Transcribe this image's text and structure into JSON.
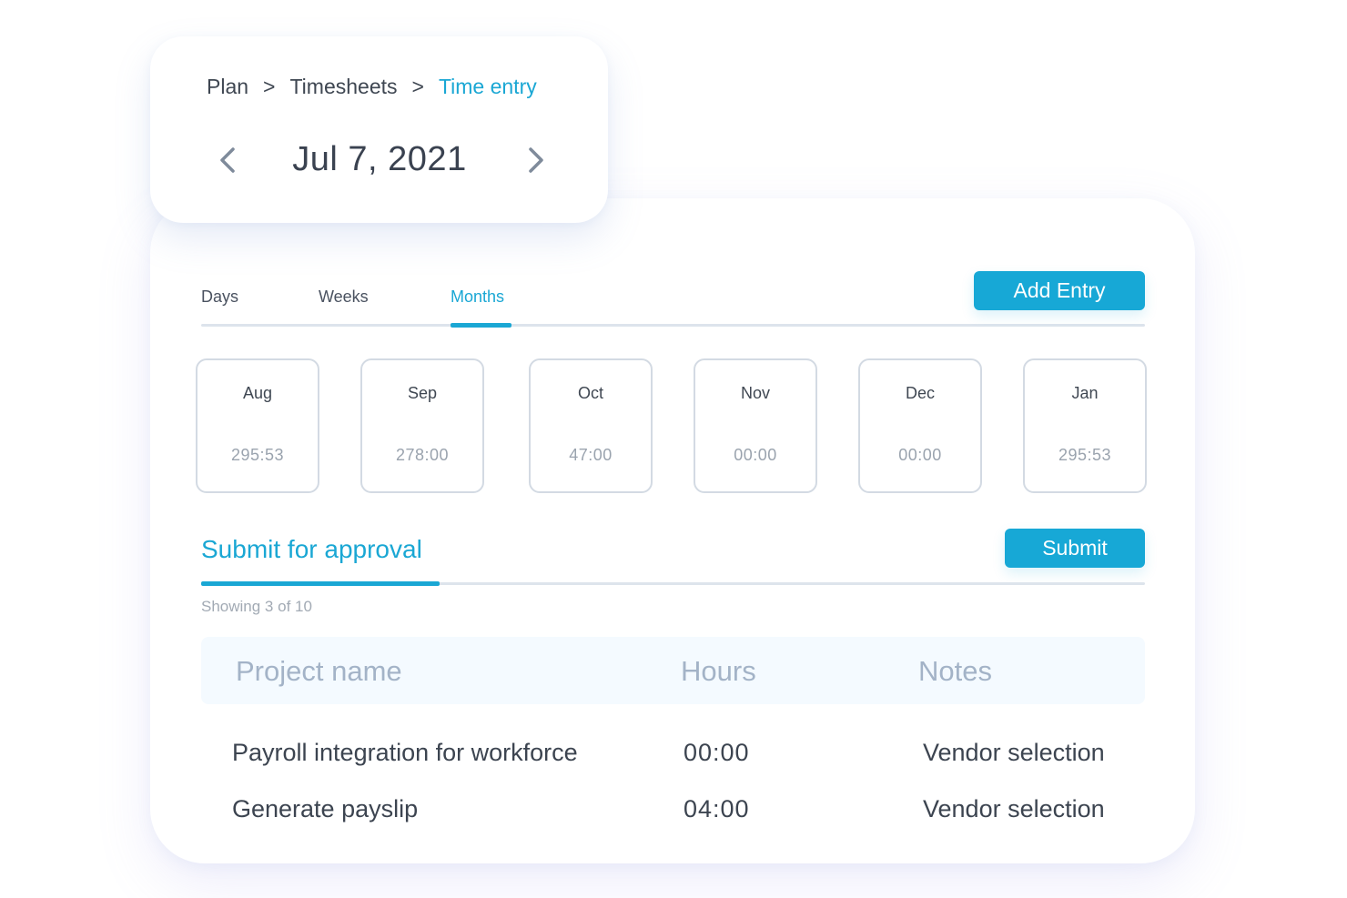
{
  "breadcrumb": {
    "items": [
      "Plan",
      "Timesheets",
      "Time entry"
    ],
    "separator": ">"
  },
  "date_nav": {
    "current_date": "Jul 7, 2021",
    "prev_icon": "chevron-left-icon",
    "next_icon": "chevron-right-icon"
  },
  "tabs": {
    "items": [
      {
        "label": "Days",
        "active": false
      },
      {
        "label": "Weeks",
        "active": false
      },
      {
        "label": "Months",
        "active": true
      }
    ]
  },
  "actions": {
    "add_entry_label": "Add Entry",
    "submit_label": "Submit"
  },
  "months": [
    {
      "name": "Aug",
      "hours": "295:53"
    },
    {
      "name": "Sep",
      "hours": "278:00"
    },
    {
      "name": "Oct",
      "hours": "47:00"
    },
    {
      "name": "Nov",
      "hours": "00:00"
    },
    {
      "name": "Dec",
      "hours": "00:00"
    },
    {
      "name": "Jan",
      "hours": "295:53"
    }
  ],
  "approval": {
    "title": "Submit for approval",
    "showing": "Showing 3 of 10"
  },
  "table": {
    "columns": [
      "Project name",
      "Hours",
      "Notes"
    ],
    "rows": [
      {
        "project": "Payroll integration for workforce",
        "hours": "00:00",
        "notes": "Vendor selection"
      },
      {
        "project": "Generate payslip",
        "hours": "04:00",
        "notes": "Vendor selection"
      }
    ]
  },
  "colors": {
    "accent": "#17a8d6",
    "text": "#3c4450",
    "muted": "#9aa3ae",
    "border": "#d3dae3"
  }
}
